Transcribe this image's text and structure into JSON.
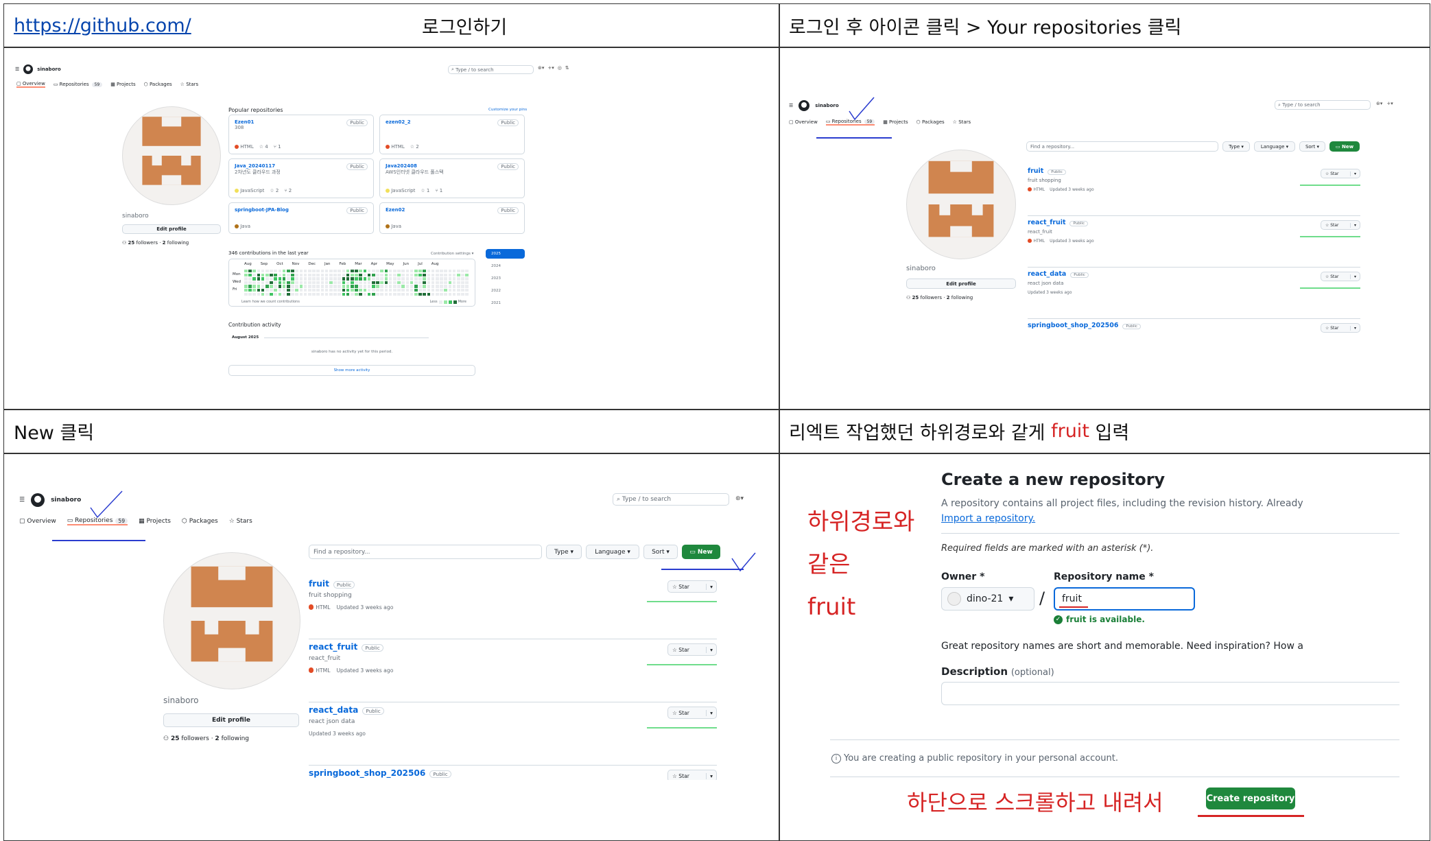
{
  "cells": {
    "c1": {
      "link": "https://github.com/",
      "title": "로그인하기"
    },
    "c2": {
      "title": "로그인 후 아이콘 클릭 > Your repositories 클릭"
    },
    "c3": {
      "title": "New 클릭"
    },
    "c4": {
      "title_prefix": "리엑트 작업했던 하위경로와 같게 ",
      "title_highlight": "fruit",
      "title_suffix": " 입력"
    }
  },
  "github": {
    "username": "sinaboro",
    "search_placeholder": "Type / to search",
    "tabs": {
      "overview": "Overview",
      "repositories": "Repositories",
      "repo_count": "59",
      "projects": "Projects",
      "packages": "Packages",
      "stars": "Stars"
    },
    "profile_name": "sinaboro",
    "edit_profile": "Edit profile",
    "followers": "25",
    "followers_label": "followers",
    "following": "2",
    "following_label": "following",
    "popular_title": "Popular repositories",
    "customize": "Customize your pins",
    "pinned": [
      {
        "name": "Ezen01",
        "badge": "Public",
        "desc": "308",
        "lang": "HTML",
        "lang_color": "#e34c26",
        "stars": "4",
        "forks": "1"
      },
      {
        "name": "ezen02_2",
        "badge": "Public",
        "desc": "",
        "lang": "HTML",
        "lang_color": "#e34c26",
        "stars": "2",
        "forks": ""
      },
      {
        "name": "Java_20240117",
        "badge": "Public",
        "desc": "2차년도 클라우드 과정",
        "lang": "JavaScript",
        "lang_color": "#f1e05a",
        "stars": "2",
        "forks": "2"
      },
      {
        "name": "Java202408",
        "badge": "Public",
        "desc": "AWS인터넷 클라우드 풀스택",
        "lang": "JavaScript",
        "lang_color": "#f1e05a",
        "stars": "1",
        "forks": "1"
      },
      {
        "name": "springboot-JPA-Blog",
        "badge": "Public",
        "desc": "",
        "lang": "Java",
        "lang_color": "#b07219",
        "stars": "",
        "forks": ""
      },
      {
        "name": "Ezen02",
        "badge": "Public",
        "desc": "",
        "lang": "Java",
        "lang_color": "#b07219",
        "stars": "",
        "forks": ""
      }
    ],
    "contrib_title": "346 contributions in the last year",
    "contrib_settings": "Contribution settings",
    "months": [
      "Aug",
      "Sep",
      "Oct",
      "Nov",
      "Dec",
      "Jan",
      "Feb",
      "Mar",
      "Apr",
      "May",
      "Jun",
      "Jul",
      "Aug"
    ],
    "days": [
      "Mon",
      "Wed",
      "Fri"
    ],
    "learn": "Learn how we count contributions",
    "less": "Less",
    "more": "More",
    "years": [
      "2025",
      "2024",
      "2023",
      "2022",
      "2021"
    ],
    "activity_title": "Contribution activity",
    "activity_month": "August 2025",
    "no_activity": "sinaboro has no activity yet for this period.",
    "show_more": "Show more activity",
    "find_placeholder": "Find a repository...",
    "type_btn": "Type",
    "language_btn": "Language",
    "sort_btn": "Sort",
    "new_btn": "New",
    "star_label": "Star",
    "repos": [
      {
        "name": "fruit",
        "badge": "Public",
        "desc": "fruit shopping",
        "lang": "HTML",
        "updated": "Updated 3 weeks ago"
      },
      {
        "name": "react_fruit",
        "badge": "Public",
        "desc": "react_fruit",
        "lang": "HTML",
        "updated": "Updated 3 weeks ago"
      },
      {
        "name": "react_data",
        "badge": "Public",
        "desc": "react json data",
        "lang": "",
        "updated": "Updated 3 weeks ago"
      },
      {
        "name": "springboot_shop_202506",
        "badge": "Public",
        "desc": "",
        "lang": "",
        "updated": ""
      }
    ]
  },
  "create": {
    "annot_lines": [
      "하위경로와",
      "같은",
      "fruit"
    ],
    "title": "Create a new repository",
    "intro": "A repository contains all project files, including the revision history. Already",
    "import_link": "Import a repository.",
    "required": "Required fields are marked with an asterisk (*).",
    "owner_label": "Owner *",
    "owner_value": "dino-21",
    "slash": "/",
    "repo_label": "Repository name *",
    "repo_value": "fruit",
    "available": "fruit is available.",
    "great": "Great repository names are short and memorable. Need inspiration? How a",
    "desc_label": "Description",
    "desc_optional": "(optional)",
    "public_note": "You are creating a public repository in your personal account.",
    "scroll_note": "하단으로 스크롤하고 내려서",
    "create_btn": "Create repository"
  }
}
